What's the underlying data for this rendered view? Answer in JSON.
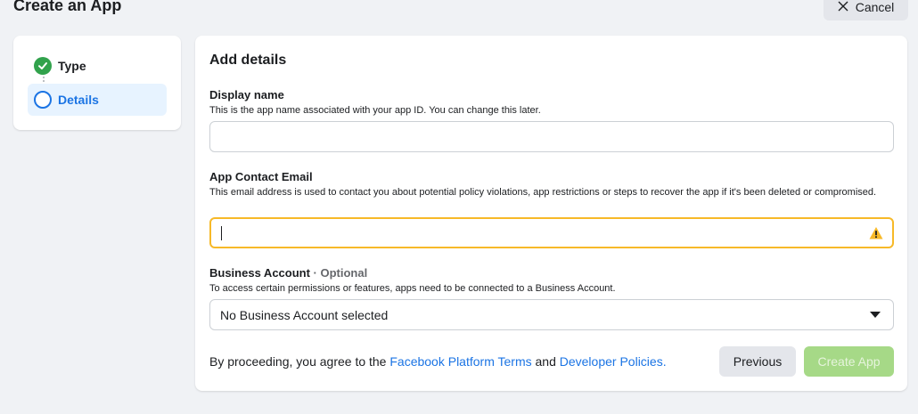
{
  "header": {
    "title": "Create an App",
    "cancel_label": "Cancel"
  },
  "steps": [
    {
      "label": "Type",
      "status": "complete"
    },
    {
      "label": "Details",
      "status": "current"
    }
  ],
  "form": {
    "section_title": "Add details",
    "display_name": {
      "label": "Display name",
      "help": "This is the app name associated with your app ID. You can change this later.",
      "value": ""
    },
    "contact_email": {
      "label": "App Contact Email",
      "help": "This email address is used to contact you about potential policy violations, app restrictions or steps to recover the app if it's been deleted or compromised.",
      "value": "",
      "state": "warning"
    },
    "business_account": {
      "label": "Business Account",
      "optional_label": " · Optional",
      "help": "To access certain permissions or features, apps need to be connected to a Business Account.",
      "selected": "No Business Account selected"
    }
  },
  "footer": {
    "terms_prefix": "By proceeding, you agree to the ",
    "terms_link": "Facebook Platform Terms",
    "terms_and": " and ",
    "policies_link": "Developer Policies.",
    "previous_label": "Previous",
    "create_label": "Create App"
  },
  "colors": {
    "accent": "#1b74e4",
    "success": "#31a24c",
    "warning": "#f7b928",
    "create_disabled": "#a6d987",
    "background": "#f0f2f5"
  }
}
